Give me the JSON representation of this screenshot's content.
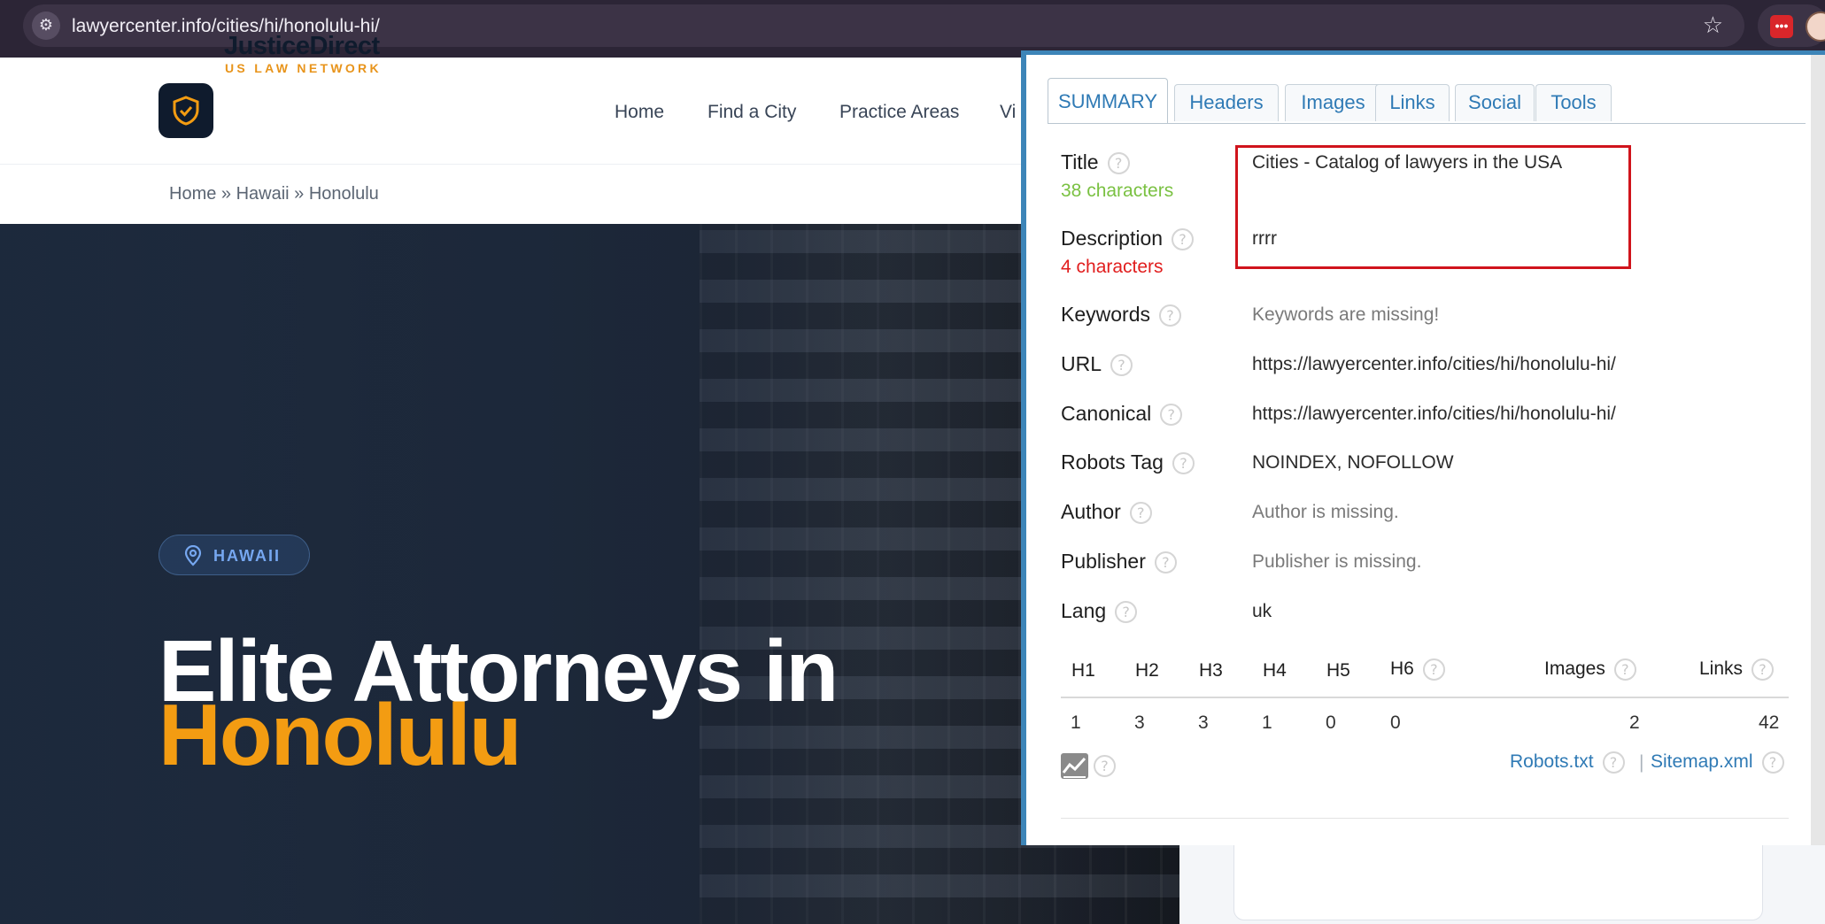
{
  "browser": {
    "url": "lawyercenter.info/cities/hi/honolulu-hi/",
    "site_info_icon": "tune-icon",
    "bookmark_icon": "star-icon",
    "extension_label": "•••"
  },
  "site": {
    "brand": "JusticeDirect",
    "tagline": "US LAW NETWORK",
    "nav": [
      "Home",
      "Find a City",
      "Practice Areas",
      "Vi"
    ],
    "breadcrumb": "Home » Hawaii » Honolulu",
    "hero": {
      "location": "HAWAII",
      "title_line1": "Elite Attorneys in",
      "title_line2": "Honolulu"
    },
    "colors": {
      "navy": "#0f1b2d",
      "accent": "#f39c12"
    }
  },
  "seo_popup": {
    "tabs": [
      "SUMMARY",
      "Headers",
      "Images",
      "Links",
      "Social",
      "Tools"
    ],
    "active_tab": "SUMMARY",
    "help": "?",
    "title": {
      "label": "Title",
      "count": "38 characters",
      "value": "Cities - Catalog of lawyers in the USA"
    },
    "description": {
      "label": "Description",
      "count": "4 characters",
      "value": "rrrr"
    },
    "keywords": {
      "label": "Keywords",
      "value": "Keywords are missing!"
    },
    "url": {
      "label": "URL",
      "value": "https://lawyercenter.info/cities/hi/honolulu-hi/"
    },
    "canonical": {
      "label": "Canonical",
      "value": "https://lawyercenter.info/cities/hi/honolulu-hi/"
    },
    "robots_tag": {
      "label": "Robots Tag",
      "value": "NOINDEX, NOFOLLOW"
    },
    "author": {
      "label": "Author",
      "value": "Author is missing."
    },
    "publisher": {
      "label": "Publisher",
      "value": "Publisher is missing."
    },
    "lang": {
      "label": "Lang",
      "value": "uk"
    },
    "headings": {
      "columns": [
        "H1",
        "H2",
        "H3",
        "H4",
        "H5",
        "H6",
        "Images",
        "Links"
      ],
      "values": [
        "1",
        "3",
        "3",
        "1",
        "0",
        "0",
        "2",
        "42"
      ]
    },
    "footer": {
      "robots_link": "Robots.txt",
      "separator": "|",
      "sitemap_link": "Sitemap.xml"
    },
    "colors": {
      "good": "#7ac142",
      "bad": "#e11e1e",
      "link": "#2f7ab5",
      "highlight": "#d0141c"
    }
  }
}
